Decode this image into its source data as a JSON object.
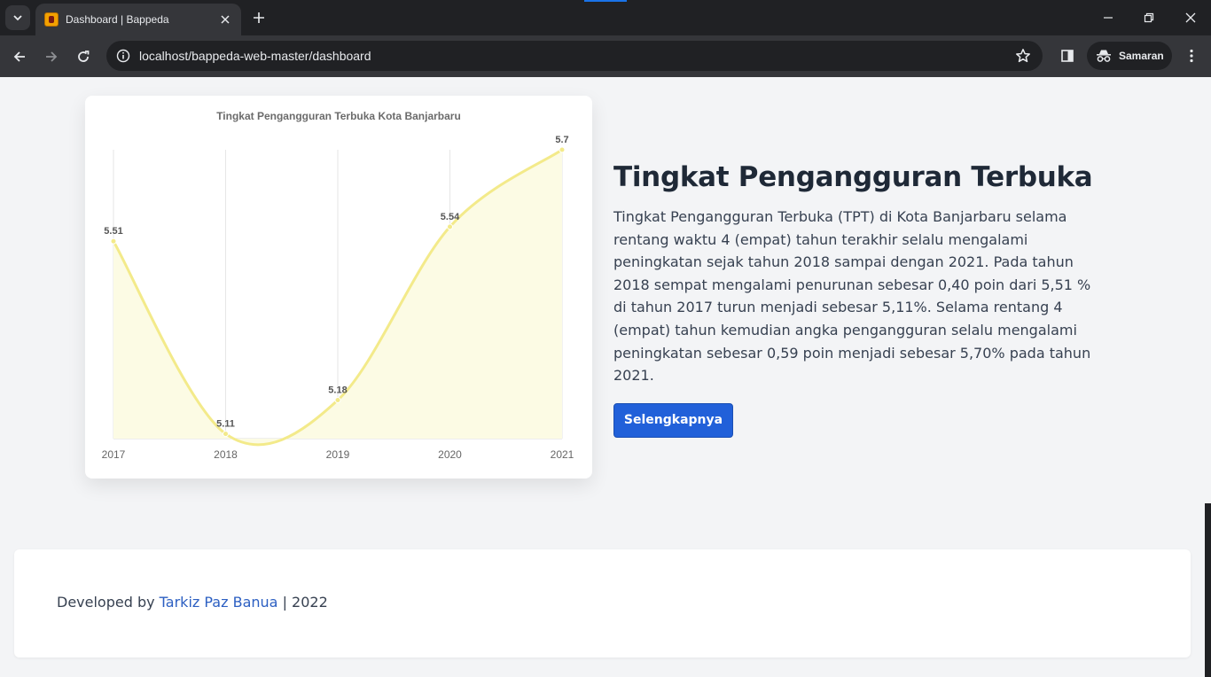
{
  "browser": {
    "tab_title": "Dashboard | Bappeda",
    "url": "localhost/bappeda-web-master/dashboard",
    "profile_label": "Samaran"
  },
  "section": {
    "heading": "Tingkat Pengangguran Terbuka",
    "description": "Tingkat Pengangguran Terbuka (TPT) di Kota Banjarbaru selama rentang waktu 4 (empat) tahun terakhir selalu mengalami peningkatan sejak tahun 2018 sampai dengan 2021. Pada tahun 2018 sempat mengalami penurunan sebesar 0,40 poin dari 5,51 % di tahun 2017 turun menjadi sebesar 5,11%. Selama rentang 4 (empat) tahun kemudian angka pengangguran selalu mengalami peningkatan sebesar 0,59 poin menjadi sebesar 5,70% pada tahun 2021.",
    "button_label": "Selengkapnya"
  },
  "chart_data": {
    "type": "area",
    "title": "Tingkat Pengangguran Terbuka Kota Banjarbaru",
    "categories": [
      "2017",
      "2018",
      "2019",
      "2020",
      "2021"
    ],
    "values": [
      5.51,
      5.11,
      5.18,
      5.54,
      5.7
    ],
    "data_labels": [
      "5.51",
      "5.11",
      "5.18",
      "5.54",
      "5.7"
    ],
    "ylim": [
      5.1,
      5.7
    ],
    "line_color": "#f3ea8a",
    "fill_color": "#fcfbe4",
    "grid": "vertical",
    "smooth": true
  },
  "footer": {
    "prefix": "Developed by",
    "author": "Tarkiz Paz Banua",
    "suffix": "| 2022"
  }
}
